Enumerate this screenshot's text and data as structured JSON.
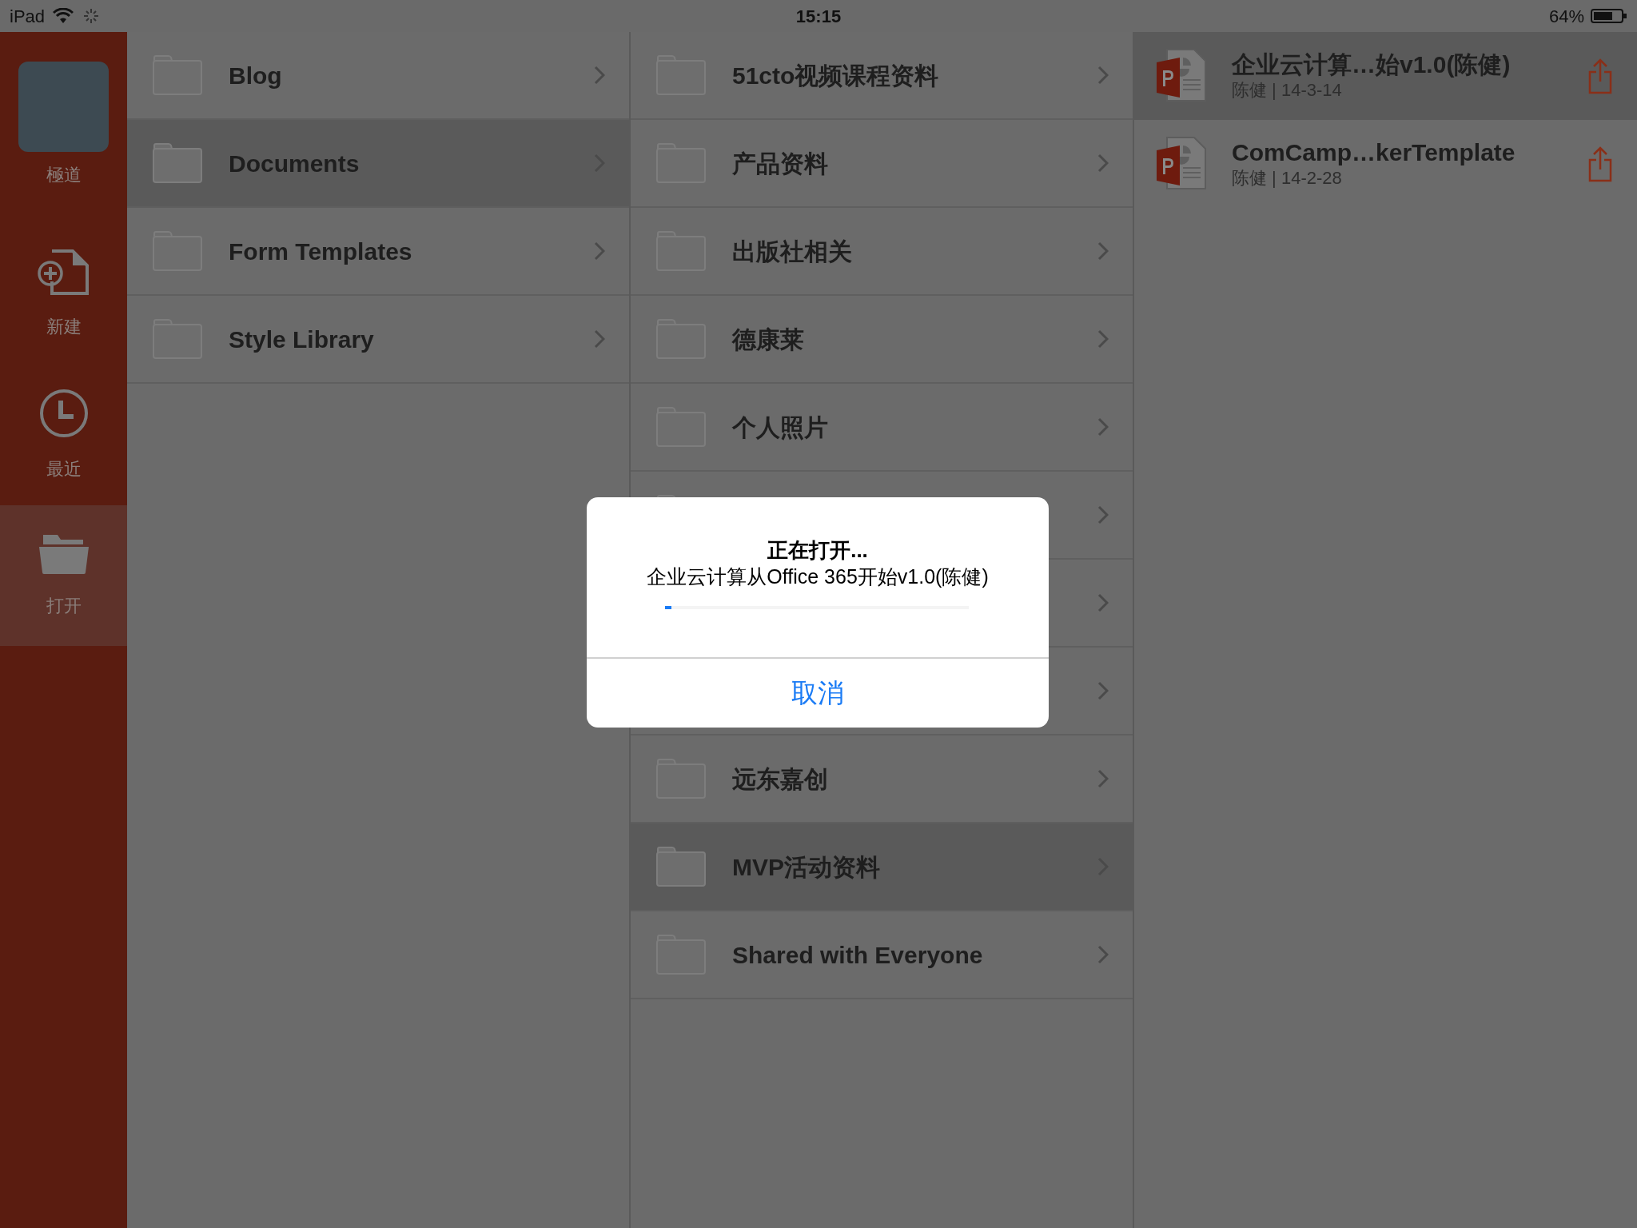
{
  "status_bar": {
    "device": "iPad",
    "time": "15:15",
    "battery": "64%"
  },
  "sidebar": {
    "user": "極道",
    "items": [
      {
        "kind": "new",
        "label": "新建",
        "selected": false
      },
      {
        "kind": "recent",
        "label": "最近",
        "selected": false
      },
      {
        "kind": "open",
        "label": "打开",
        "selected": true
      }
    ]
  },
  "column_1": [
    {
      "kind": "folder",
      "label": "Blog",
      "selected": false
    },
    {
      "kind": "folder",
      "label": "Documents",
      "selected": true
    },
    {
      "kind": "folder",
      "label": "Form Templates",
      "selected": false
    },
    {
      "kind": "folder",
      "label": "Style Library",
      "selected": false
    }
  ],
  "column_2": [
    {
      "kind": "folder",
      "label": "51cto视频课程资料",
      "selected": false
    },
    {
      "kind": "folder",
      "label": "产品资料",
      "selected": false
    },
    {
      "kind": "folder",
      "label": "出版社相关",
      "selected": false
    },
    {
      "kind": "folder",
      "label": "德康莱",
      "selected": false
    },
    {
      "kind": "folder",
      "label": "个人照片",
      "selected": false
    },
    {
      "kind": "folder",
      "selected": false
    },
    {
      "kind": "covered",
      "selected": false
    },
    {
      "kind": "covered",
      "selected": false
    },
    {
      "kind": "folder",
      "label": "远东嘉创",
      "selected": false
    },
    {
      "kind": "folder",
      "label": "MVP活动资料",
      "selected": true
    },
    {
      "kind": "folder",
      "label": "Shared with Everyone",
      "selected": false
    }
  ],
  "files": [
    {
      "name": "企业云计算…始v1.0(陈健)",
      "meta": "陈健 | 14-3-14",
      "selected": true
    },
    {
      "name": "ComCamp…kerTemplate",
      "meta": "陈健 | 14-2-28",
      "selected": false
    }
  ],
  "dialog": {
    "title": "正在打开...",
    "message": "企业云计算从Office 365开始v1.0(陈健)",
    "level": 0.02,
    "button": "取消"
  }
}
